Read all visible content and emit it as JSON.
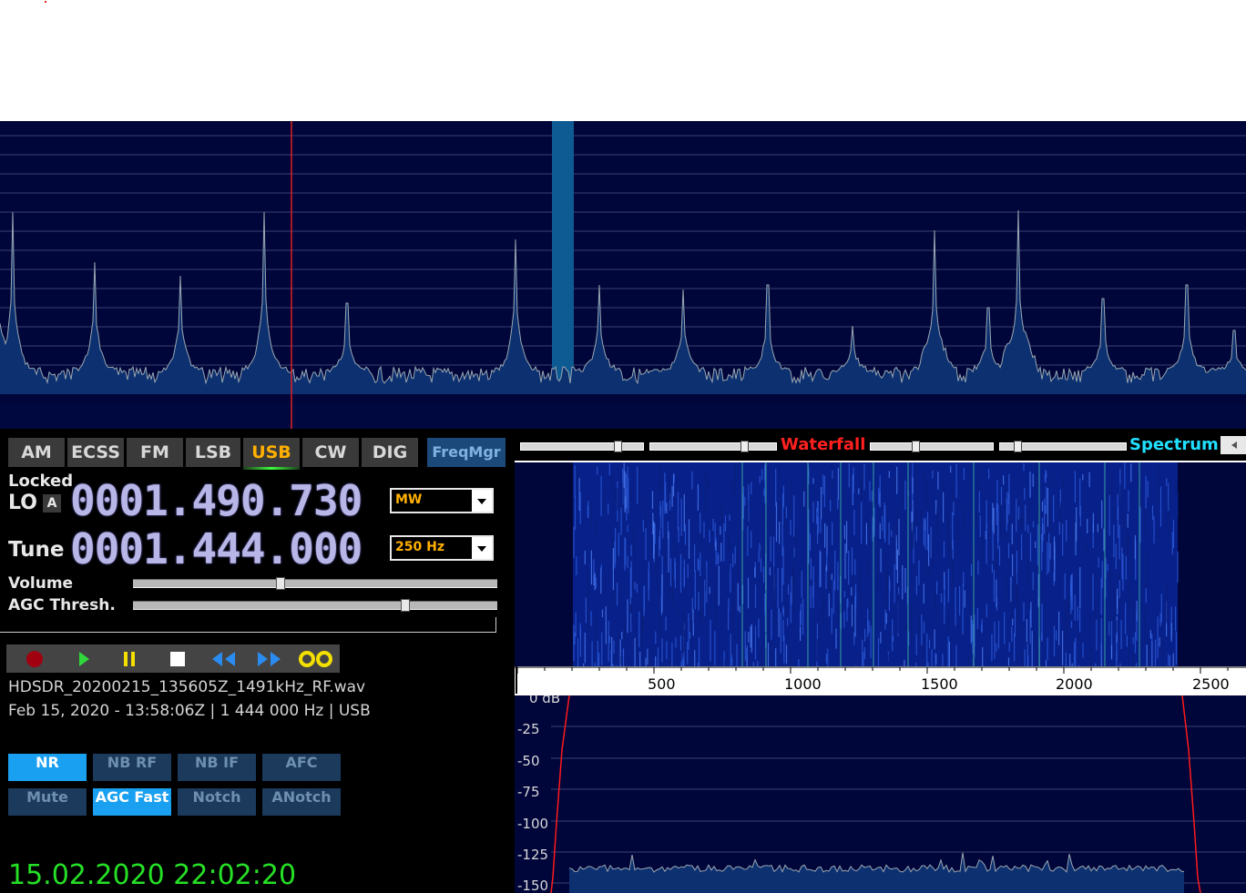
{
  "modes": [
    "AM",
    "ECSS",
    "FM",
    "LSB",
    "USB",
    "CW",
    "DIG"
  ],
  "active_mode": "USB",
  "freqmgr_label": "FreqMgr",
  "lo": {
    "status": "Locked",
    "label": "LO",
    "badge": "A",
    "frequency": "0001.490.730",
    "band": "MW"
  },
  "tune": {
    "label": "Tune",
    "frequency": "0001.444.000",
    "bandwidth": "250 Hz"
  },
  "volume": {
    "label": "Volume",
    "level": 0.4
  },
  "agc_thresh": {
    "label": "AGC Thresh.",
    "level": 0.75
  },
  "recording": {
    "filename": "HDSDR_20200215_135605Z_1491kHz_RF.wav",
    "info": "Feb 15, 2020 - 13:58:06Z | 1 444 000 Hz | USB"
  },
  "dsp_buttons_row1": [
    {
      "label": "NR",
      "on": true
    },
    {
      "label": "NB RF",
      "on": false
    },
    {
      "label": "NB IF",
      "on": false
    },
    {
      "label": "AFC",
      "on": false
    }
  ],
  "dsp_buttons_row2": [
    {
      "label": "Mute",
      "on": false
    },
    {
      "label": "AGC Fast",
      "on": true
    },
    {
      "label": "Notch",
      "on": false
    },
    {
      "label": "ANotch",
      "on": false
    }
  ],
  "clock": "15.02.2020 22:02:20",
  "waterfall_label": "Waterfall",
  "spectrum_label": "Spectrum",
  "audio_axis_labels": [
    "500",
    "1000",
    "1500",
    "2000",
    "2500"
  ],
  "db_labels": [
    "0 dB",
    "-25",
    "-50",
    "-75",
    "-100",
    "-125",
    "-150"
  ],
  "colors": {
    "spectrum_bg": "#00053a",
    "active_mode": "#ffb000",
    "dsp_on": "#1aa0f0",
    "clock": "#26e026",
    "waterfall_label": "#ff2020",
    "spectrum_label": "#20e0ff"
  }
}
